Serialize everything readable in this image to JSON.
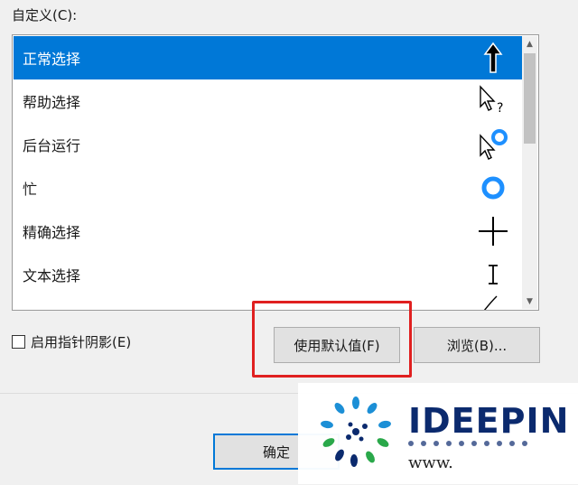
{
  "dialog": {
    "customize_label": "自定义(C):",
    "scheme_items": [
      {
        "label": "正常选择",
        "cursor_icon": "up-arrow-icon",
        "selected": true
      },
      {
        "label": "帮助选择",
        "cursor_icon": "help-cursor-icon",
        "selected": false
      },
      {
        "label": "后台运行",
        "cursor_icon": "working-in-background-icon",
        "selected": false
      },
      {
        "label": "忙",
        "cursor_icon": "busy-ring-icon",
        "selected": false
      },
      {
        "label": "精确选择",
        "cursor_icon": "crosshair-icon",
        "selected": false
      },
      {
        "label": "文本选择",
        "cursor_icon": "text-ibeam-icon",
        "selected": false
      }
    ],
    "enable_shadow_label": "启用指针阴影(E)",
    "use_default_button": "使用默认值(F)",
    "browse_button": "浏览(B)...",
    "ok_button": "确定"
  },
  "watermark": {
    "brand": "IDEEPIN",
    "url": "www."
  },
  "colors": {
    "selection": "#0078d7",
    "highlight_box": "#e02020",
    "brand": "#0b2a6e"
  }
}
